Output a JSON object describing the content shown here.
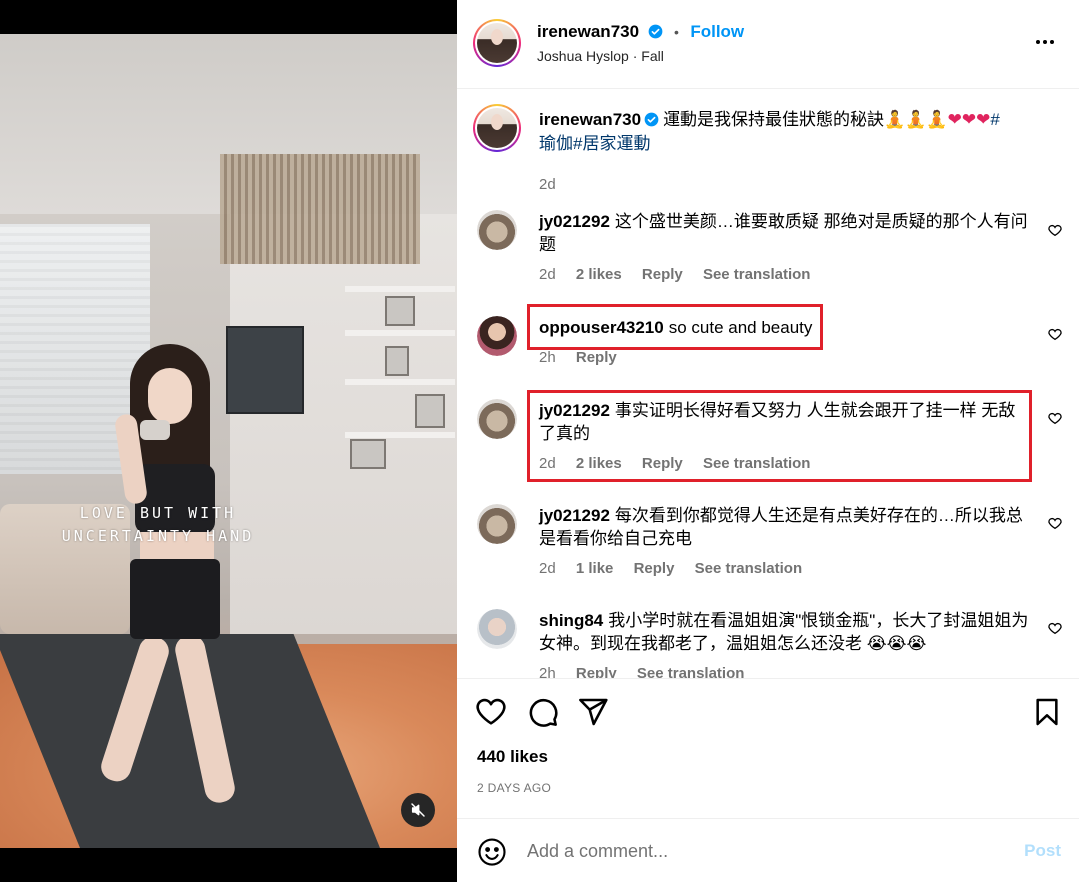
{
  "media": {
    "overlay_line1": "LOVE BUT WITH",
    "overlay_line2": "UNCERTAINTY HAND",
    "mute_icon": "speaker-muted-icon"
  },
  "header": {
    "username": "irenewan730",
    "follow_label": "Follow",
    "separator": "•",
    "audio": "Joshua Hyslop · Fall",
    "more_icon": "more-horizontal-icon"
  },
  "caption": {
    "username": "irenewan730",
    "text": "運動是我保持最佳狀態的秘訣🧘🧘🧘❤️❤️❤️#瑜伽#居家運動",
    "line1": "運動是我保持最佳狀態的秘訣",
    "emojis_yoga": "🧘🧘🧘",
    "emojis_heart": "❤❤❤",
    "tag1": "#",
    "line2": "瑜伽#居家運動",
    "time": "2d"
  },
  "comments": [
    {
      "username": "jy021292",
      "text": "这个盛世美颜…谁要敢质疑 那绝对是质疑的那个人有问题",
      "time": "2d",
      "likes": "2 likes",
      "reply": "Reply",
      "translate": "See translation"
    },
    {
      "username": "oppouser43210",
      "text": "so cute and beauty",
      "time": "2h",
      "reply": "Reply"
    },
    {
      "username": "jy021292",
      "text": "事实证明长得好看又努力 人生就会跟开了挂一样 无敌了真的",
      "time": "2d",
      "likes": "2 likes",
      "reply": "Reply",
      "translate": "See translation"
    },
    {
      "username": "jy021292",
      "text": "每次看到你都觉得人生还是有点美好存在的…所以我总是看看你给自己充电",
      "time": "2d",
      "likes": "1 like",
      "reply": "Reply",
      "translate": "See translation"
    },
    {
      "username": "shing84",
      "text": "我小学时就在看温姐姐演\"恨锁金瓶\"，长大了封温姐姐为女神。到现在我都老了，温姐姐怎么还没老 😭😭😭",
      "time": "2h",
      "reply": "Reply",
      "translate": "See translation"
    }
  ],
  "actions": {
    "like_icon": "heart-icon",
    "comment_icon": "comment-icon",
    "share_icon": "send-icon",
    "save_icon": "bookmark-icon",
    "likes": "440 likes",
    "date": "2 DAYS AGO"
  },
  "composer": {
    "placeholder": "Add a comment...",
    "post_label": "Post",
    "emoji_icon": "smiley-icon"
  },
  "colors": {
    "accent": "#0095f6",
    "highlight_box": "#e0202a",
    "muted_text": "#737373",
    "post_disabled": "#b2dffc"
  }
}
